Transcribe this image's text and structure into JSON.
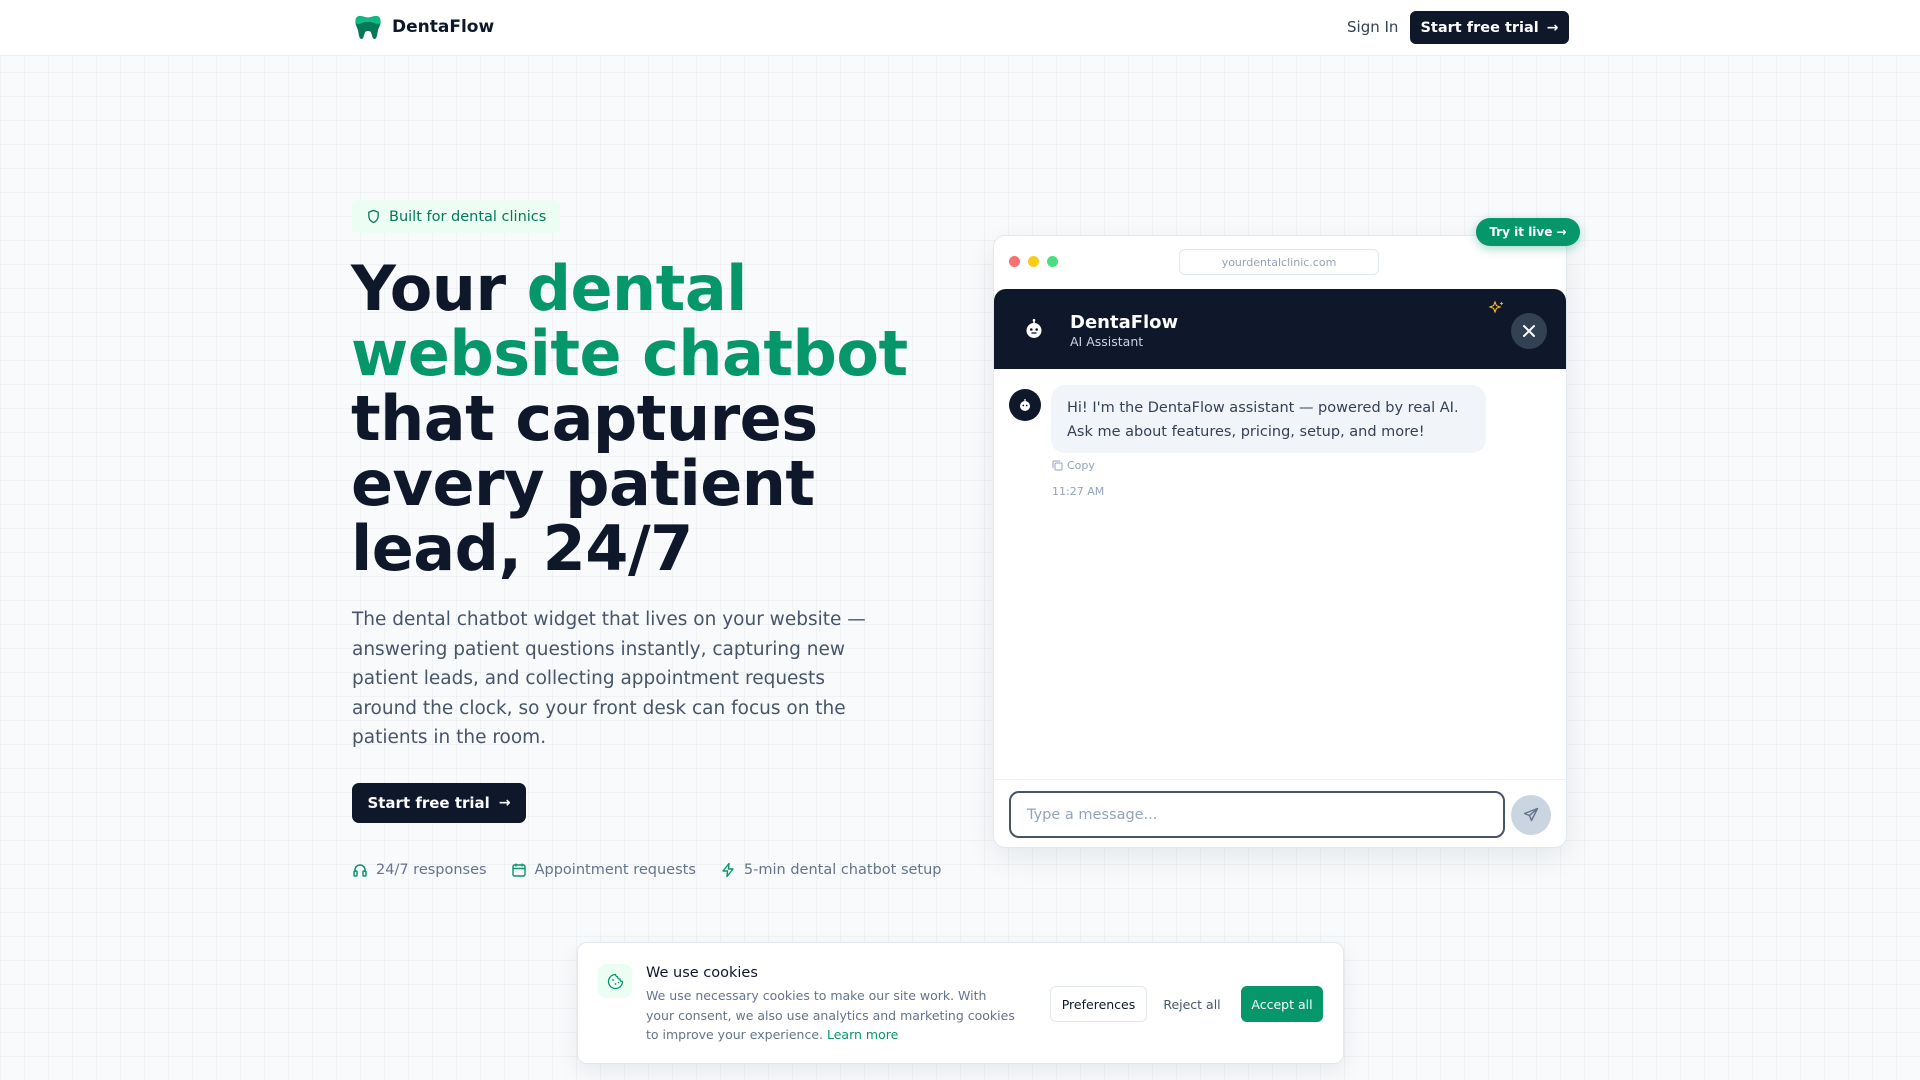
{
  "colors": {
    "accent": "#059669",
    "dark": "#0f172a",
    "accent_soft": "#ecfdf3"
  },
  "header": {
    "brand": "DentaFlow",
    "logo_icon": "tooth-icon",
    "sign_in": "Sign In",
    "cta": "Start free trial"
  },
  "hero": {
    "badge": "Built for dental clinics",
    "headline_parts": [
      "Your ",
      "dental website chatbot",
      " that captures every patient lead, 24/7"
    ],
    "subtext": "The dental chatbot widget that lives on your website — answering patient questions instantly, capturing new patient leads, and collecting appointment requests around the clock, so your front desk can focus on the patients in the room.",
    "cta": "Start free trial",
    "features": [
      {
        "icon": "headset-icon",
        "label": "24/7 responses"
      },
      {
        "icon": "calendar-icon",
        "label": "Appointment requests"
      },
      {
        "icon": "lightning-icon",
        "label": "5-min dental chatbot setup"
      }
    ]
  },
  "demo": {
    "try_live": "Try it live →",
    "url": "yourdentalclinic.com",
    "chat": {
      "title": "DentaFlow",
      "subtitle": "AI Assistant",
      "message_line1": "Hi! I'm the DentaFlow assistant — powered by real AI.",
      "message_line2": "Ask me about features, pricing, setup, and more!",
      "copy_label": "Copy",
      "time": "11:27 AM",
      "input_placeholder": "Type a message...",
      "input_value": ""
    }
  },
  "cookie": {
    "title": "We use cookies",
    "text": "We use necessary cookies to make our site work. With your consent, we also use analytics and marketing cookies to improve your experience.",
    "link": "Learn more",
    "preferences": "Preferences",
    "reject": "Reject all",
    "accept": "Accept all"
  }
}
